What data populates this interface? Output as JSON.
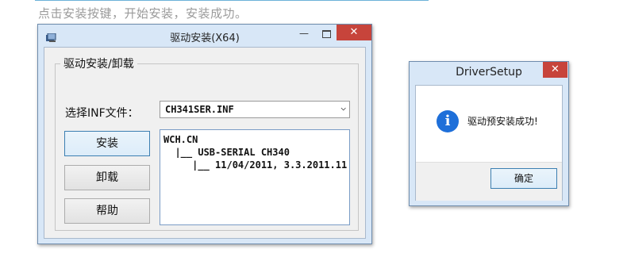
{
  "caption": "点击安装按键，开始安装，安装成功。",
  "main_window": {
    "title": "驱动安装(X64)",
    "minimize_glyph": "—",
    "close_glyph": "✕",
    "group_title": "驱动安装/卸载",
    "inf_label": "选择INF文件：",
    "inf_selected": "CH341SER.INF",
    "buttons": {
      "install": "安装",
      "uninstall": "卸载",
      "help": "帮助"
    },
    "info_lines": [
      "WCH.CN",
      "  |__ USB-SERIAL CH340",
      "     |__ 11/04/2011, 3.3.2011.11"
    ]
  },
  "dialog": {
    "title": "DriverSetup",
    "close_glyph": "✕",
    "icon_glyph": "i",
    "message": "驱动预安装成功!",
    "ok_label": "确定"
  },
  "colors": {
    "close_button": "#c7443b",
    "title_bar": "#d8e7f7",
    "info_icon": "#1e6fd9"
  }
}
